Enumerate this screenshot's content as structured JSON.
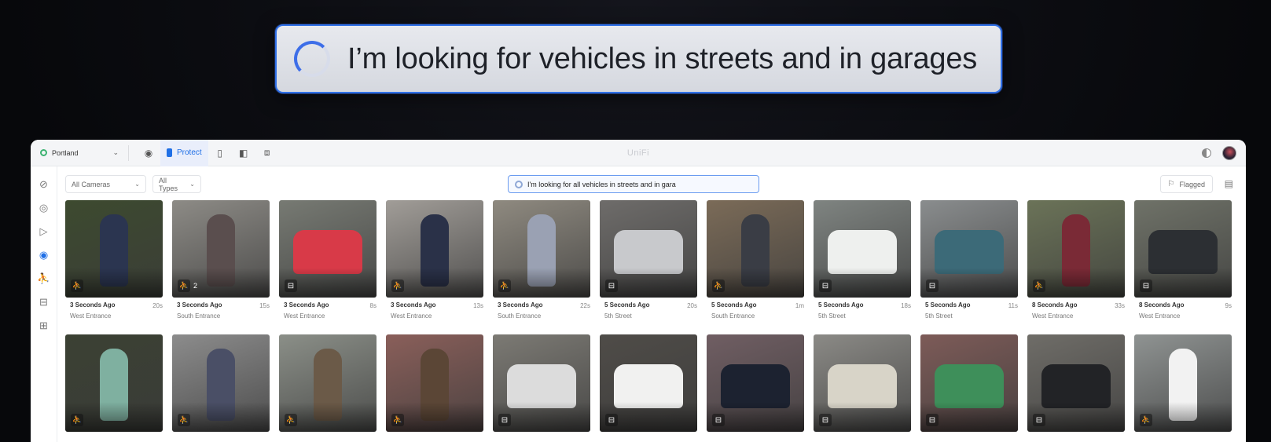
{
  "overlay": {
    "query": "I’m looking for vehicles in streets and in garages"
  },
  "topbar": {
    "site": "Portland",
    "protect_label": "Protect",
    "brand": "UniFi"
  },
  "filters": {
    "cameras": "All Cameras",
    "types": "All Types",
    "search_value": "I'm looking for all vehicles in streets and in gara",
    "flagged": "Flagged"
  },
  "events": [
    {
      "time": "3 Seconds Ago",
      "duration": "20s",
      "camera": "West Entrance",
      "type": "person",
      "count": "",
      "bg": "#3d4a2f",
      "fg": "#2b3550"
    },
    {
      "time": "3 Seconds Ago",
      "duration": "15s",
      "camera": "South Entrance",
      "type": "person",
      "count": "2",
      "bg": "#8d8b86",
      "fg": "#5a4e4e"
    },
    {
      "time": "3 Seconds Ago",
      "duration": "8s",
      "camera": "West Entrance",
      "type": "vehicle",
      "count": "",
      "bg": "#777a73",
      "fg": "#d83a48"
    },
    {
      "time": "3 Seconds Ago",
      "duration": "13s",
      "camera": "West Entrance",
      "type": "person",
      "count": "",
      "bg": "#a19d98",
      "fg": "#2a3148"
    },
    {
      "time": "3 Seconds Ago",
      "duration": "22s",
      "camera": "South Entrance",
      "type": "person",
      "count": "",
      "bg": "#8f8a80",
      "fg": "#9aa1b3"
    },
    {
      "time": "5 Seconds Ago",
      "duration": "20s",
      "camera": "5th Street",
      "type": "vehicle",
      "count": "",
      "bg": "#6e6c6a",
      "fg": "#c8c9cc"
    },
    {
      "time": "5 Seconds Ago",
      "duration": "1m",
      "camera": "South Entrance",
      "type": "person",
      "count": "",
      "bg": "#7b6b58",
      "fg": "#3a3d45"
    },
    {
      "time": "5 Seconds Ago",
      "duration": "18s",
      "camera": "5th Street",
      "type": "vehicle",
      "count": "",
      "bg": "#7f8481",
      "fg": "#eef0ee"
    },
    {
      "time": "5 Seconds Ago",
      "duration": "11s",
      "camera": "5th Street",
      "type": "vehicle",
      "count": "",
      "bg": "#8a8d8e",
      "fg": "#3c6a78"
    },
    {
      "time": "8 Seconds Ago",
      "duration": "33s",
      "camera": "West Entrance",
      "type": "person",
      "count": "",
      "bg": "#6b7358",
      "fg": "#7a2a36"
    },
    {
      "time": "8 Seconds Ago",
      "duration": "9s",
      "camera": "West Entrance",
      "type": "vehicle",
      "count": "",
      "bg": "#6f7268",
      "fg": "#2c2f33"
    },
    {
      "time": "",
      "duration": "",
      "camera": "",
      "type": "person",
      "count": "",
      "bg": "#3b4133",
      "fg": "#7fb0a0"
    },
    {
      "time": "",
      "duration": "",
      "camera": "",
      "type": "person",
      "count": "",
      "bg": "#8c8c8c",
      "fg": "#4a4f66"
    },
    {
      "time": "",
      "duration": "",
      "camera": "",
      "type": "person",
      "count": "",
      "bg": "#8b8f88",
      "fg": "#6b5a48"
    },
    {
      "time": "",
      "duration": "",
      "camera": "",
      "type": "person",
      "count": "",
      "bg": "#8a5f5a",
      "fg": "#5b4636"
    },
    {
      "time": "",
      "duration": "",
      "camera": "",
      "type": "vehicle",
      "count": "",
      "bg": "#7c7a74",
      "fg": "#dcdcdc"
    },
    {
      "time": "",
      "duration": "",
      "camera": "",
      "type": "vehicle",
      "count": "",
      "bg": "#4f4c48",
      "fg": "#f1f1f0"
    },
    {
      "time": "",
      "duration": "",
      "camera": "",
      "type": "vehicle",
      "count": "",
      "bg": "#705e63",
      "fg": "#1c2230"
    },
    {
      "time": "",
      "duration": "",
      "camera": "",
      "type": "vehicle",
      "count": "",
      "bg": "#8b8a86",
      "fg": "#d8d4c8"
    },
    {
      "time": "",
      "duration": "",
      "camera": "",
      "type": "vehicle",
      "count": "",
      "bg": "#7d5b58",
      "fg": "#3e8f5a"
    },
    {
      "time": "",
      "duration": "",
      "camera": "",
      "type": "vehicle",
      "count": "",
      "bg": "#6f6d68",
      "fg": "#222326"
    },
    {
      "time": "",
      "duration": "",
      "camera": "",
      "type": "person",
      "count": "",
      "bg": "#8f9392",
      "fg": "#f2f2f2"
    }
  ]
}
